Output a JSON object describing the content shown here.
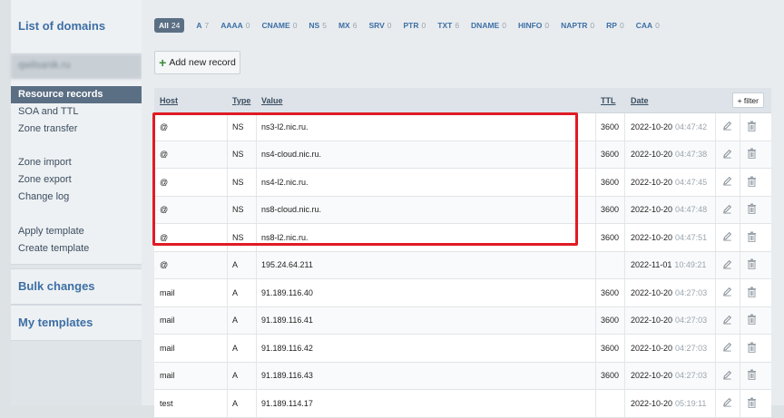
{
  "sidebar": {
    "list_of_domains": "List of domains",
    "domain_name": "qwilsanik.ru",
    "menu": [
      {
        "label": "Resource records",
        "active": true
      },
      {
        "label": "SOA and TTL"
      },
      {
        "label": "Zone transfer"
      },
      null,
      {
        "label": "Zone import"
      },
      {
        "label": "Zone export"
      },
      {
        "label": "Change log"
      },
      null,
      {
        "label": "Apply template"
      },
      {
        "label": "Create template"
      }
    ],
    "bulk_changes": "Bulk changes",
    "my_templates": "My templates"
  },
  "filters": [
    {
      "label": "All",
      "count": "24",
      "active": true
    },
    {
      "label": "A",
      "count": "7"
    },
    {
      "label": "AAAA",
      "count": "0"
    },
    {
      "label": "CNAME",
      "count": "0"
    },
    {
      "label": "NS",
      "count": "5"
    },
    {
      "label": "MX",
      "count": "6"
    },
    {
      "label": "SRV",
      "count": "0"
    },
    {
      "label": "PTR",
      "count": "0"
    },
    {
      "label": "TXT",
      "count": "6"
    },
    {
      "label": "DNAME",
      "count": "0"
    },
    {
      "label": "HINFO",
      "count": "0"
    },
    {
      "label": "NAPTR",
      "count": "0"
    },
    {
      "label": "RP",
      "count": "0"
    },
    {
      "label": "CAA",
      "count": "0"
    }
  ],
  "add_record_label": "Add new record",
  "table": {
    "headers": {
      "host": "Host",
      "type": "Type",
      "value": "Value",
      "ttl": "TTL",
      "date": "Date"
    },
    "filter_button": "+ filter",
    "rows": [
      {
        "host": "@",
        "type": "NS",
        "value": "ns3-l2.nic.ru.",
        "ttl": "3600",
        "date": "2022-10-20",
        "time": "04:47:42"
      },
      {
        "host": "@",
        "type": "NS",
        "value": "ns4-cloud.nic.ru.",
        "ttl": "3600",
        "date": "2022-10-20",
        "time": "04:47:38"
      },
      {
        "host": "@",
        "type": "NS",
        "value": "ns4-l2.nic.ru.",
        "ttl": "3600",
        "date": "2022-10-20",
        "time": "04:47:45"
      },
      {
        "host": "@",
        "type": "NS",
        "value": "ns8-cloud.nic.ru.",
        "ttl": "3600",
        "date": "2022-10-20",
        "time": "04:47:48"
      },
      {
        "host": "@",
        "type": "NS",
        "value": "ns8-l2.nic.ru.",
        "ttl": "3600",
        "date": "2022-10-20",
        "time": "04:47:51"
      },
      {
        "host": "@",
        "type": "A",
        "value": "195.24.64.211",
        "ttl": "",
        "date": "2022-11-01",
        "time": "10:49:21"
      },
      {
        "host": "mail",
        "type": "A",
        "value": "91.189.116.40",
        "ttl": "3600",
        "date": "2022-10-20",
        "time": "04:27:03"
      },
      {
        "host": "mail",
        "type": "A",
        "value": "91.189.116.41",
        "ttl": "3600",
        "date": "2022-10-20",
        "time": "04:27:03"
      },
      {
        "host": "mail",
        "type": "A",
        "value": "91.189.116.42",
        "ttl": "3600",
        "date": "2022-10-20",
        "time": "04:27:03"
      },
      {
        "host": "mail",
        "type": "A",
        "value": "91.189.116.43",
        "ttl": "3600",
        "date": "2022-10-20",
        "time": "04:27:03"
      },
      {
        "host": "test",
        "type": "A",
        "value": "91.189.114.17",
        "ttl": "",
        "date": "2022-10-20",
        "time": "05:19:11"
      }
    ]
  },
  "icons": {
    "edit": "pencil-icon",
    "delete": "trash-icon",
    "add": "plus-icon"
  },
  "colors": {
    "highlight": "#e01b24",
    "link": "#3d6fa5",
    "active_bg": "#5b6f84"
  }
}
